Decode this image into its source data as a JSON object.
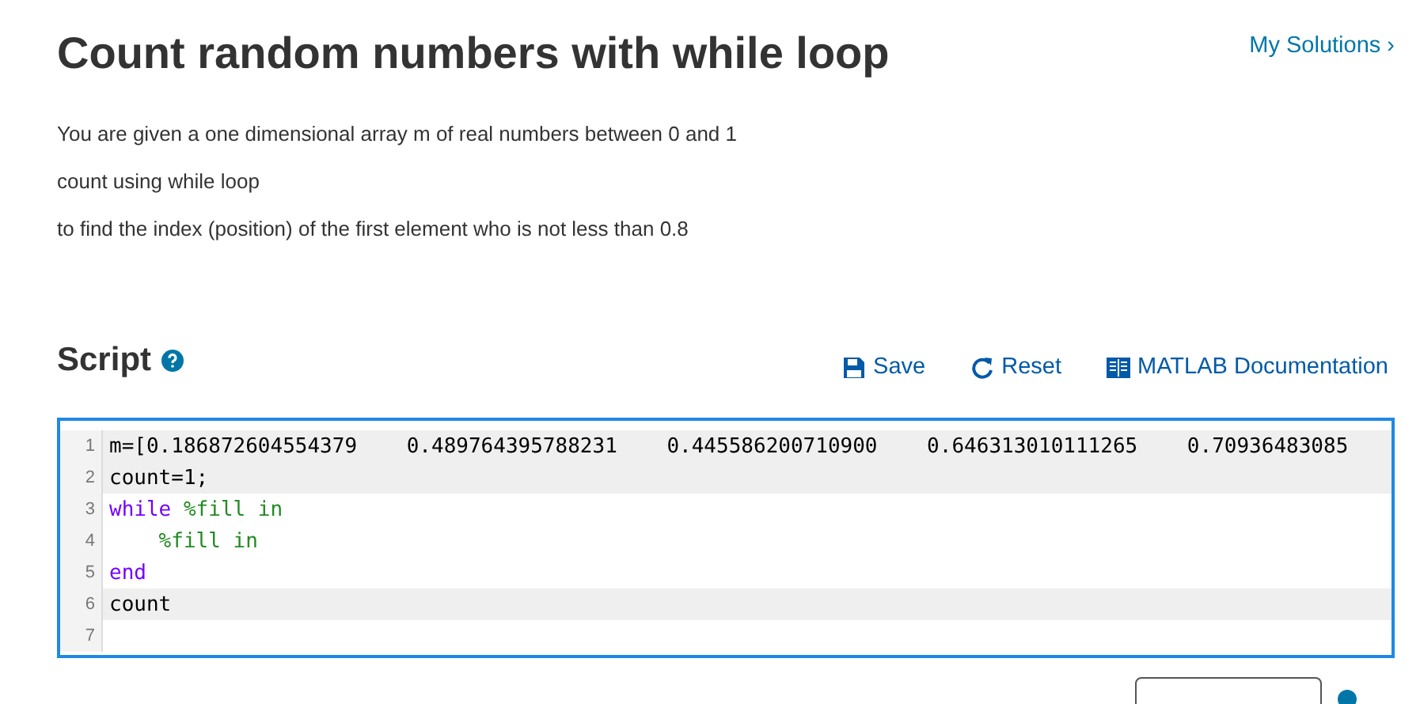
{
  "title": "Count random numbers with while loop",
  "my_solutions_link": "My Solutions ›",
  "description": [
    "You are given a one dimensional array m of real numbers between 0 and 1",
    "count using while loop",
    "to find the index (position) of the first element who is not less than 0.8"
  ],
  "script": {
    "heading": "Script",
    "toolbar": [
      "Save",
      "Reset",
      "MATLAB Documentation"
    ],
    "lines": [
      {
        "number": "1",
        "locked": true,
        "tokens": [
          {
            "kind": "plain",
            "text": "m=[0.186872604554379    0.489764395788231    0.445586200710900    0.646313010111265    0.70936483085"
          }
        ]
      },
      {
        "number": "2",
        "locked": true,
        "tokens": [
          {
            "kind": "plain",
            "text": "count=1;"
          }
        ]
      },
      {
        "number": "3",
        "locked": false,
        "tokens": [
          {
            "kind": "keyword",
            "text": "while"
          },
          {
            "kind": "comment",
            "text": " %fill in"
          }
        ]
      },
      {
        "number": "4",
        "locked": false,
        "tokens": [
          {
            "kind": "comment",
            "text": "    %fill in"
          }
        ]
      },
      {
        "number": "5",
        "locked": false,
        "tokens": [
          {
            "kind": "keyword",
            "text": "end"
          }
        ]
      },
      {
        "number": "6",
        "locked": true,
        "tokens": [
          {
            "kind": "plain",
            "text": "count"
          }
        ]
      },
      {
        "number": "7",
        "locked": false
      }
    ]
  }
}
